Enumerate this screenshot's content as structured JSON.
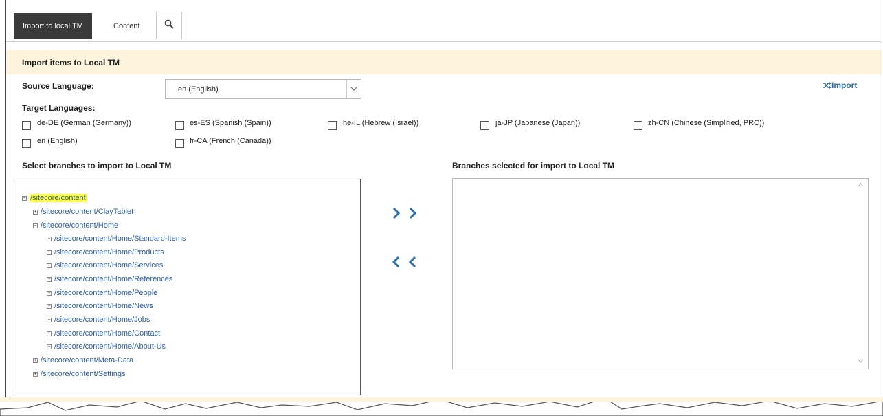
{
  "tabs": {
    "import_tab": "Import to local TM",
    "content_tab": "Content",
    "search_icon": "search-icon"
  },
  "section": {
    "title": "Import items to Local TM"
  },
  "source_language": {
    "label": "Source Language:",
    "selected": "en (English)"
  },
  "import_action": {
    "label": "Import",
    "icon": "shuffle-icon"
  },
  "target_languages": {
    "label": "Target Languages:",
    "options": [
      "de-DE (German (Germany))",
      "es-ES (Spanish (Spain))",
      "he-IL (Hebrew (Israel))",
      "ja-JP (Japanese (Japan))",
      "zh-CN (Chinese (Simplified, PRC))",
      "en (English)",
      "fr-CA (French (Canada))"
    ]
  },
  "branches": {
    "select_label": "Select branches to import to Local TM",
    "selected_label": "Branches selected for import to Local TM",
    "tree": [
      "/sitecore/content",
      "/sitecore/content/ClayTablet",
      "/sitecore/content/Home",
      "/sitecore/content/Home/Standard-Items",
      "/sitecore/content/Home/Products",
      "/sitecore/content/Home/Services",
      "/sitecore/content/Home/References",
      "/sitecore/content/Home/People",
      "/sitecore/content/Home/News",
      "/sitecore/content/Home/Jobs",
      "/sitecore/content/Home/Contact",
      "/sitecore/content/Home/About-Us",
      "/sitecore/content/Meta-Data",
      "/sitecore/content/Settings"
    ]
  },
  "colors": {
    "accent": "#2a6fb5",
    "header_bg": "#fcf4dd",
    "highlight": "#ffff33",
    "tab_active": "#3a3a3a"
  }
}
